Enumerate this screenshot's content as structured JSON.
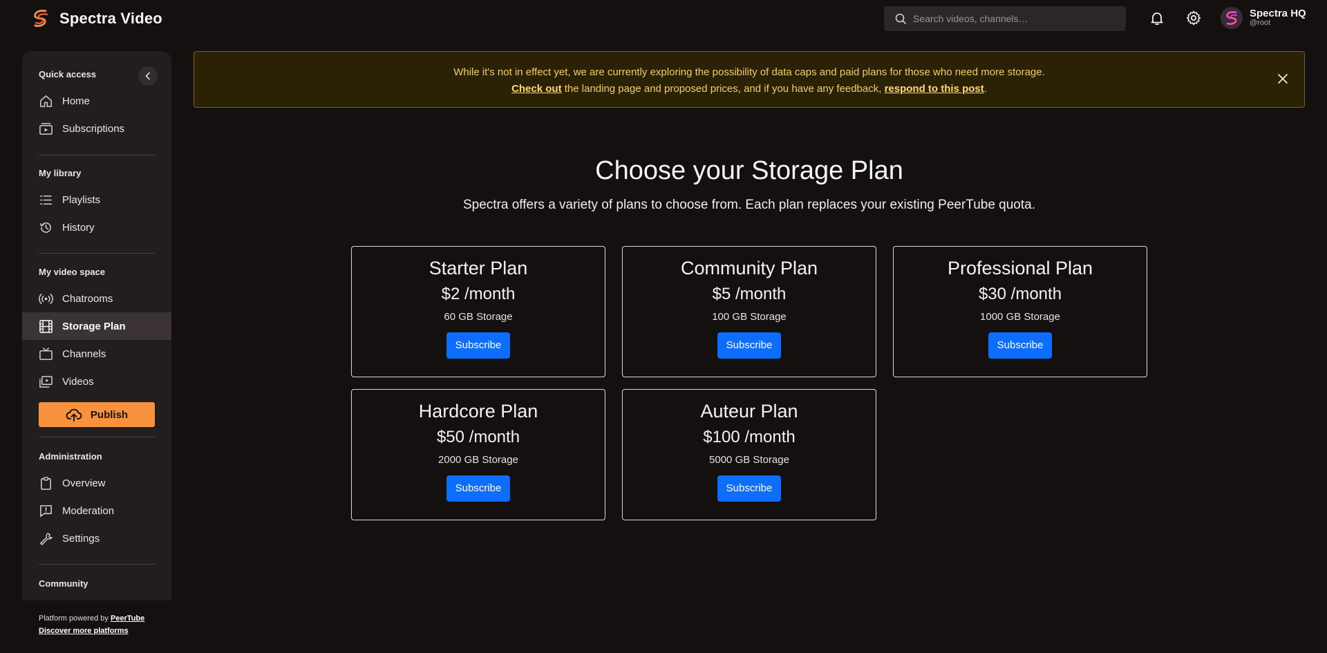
{
  "header": {
    "brand": "Spectra Video",
    "search_placeholder": "Search videos, channels…",
    "user_name": "Spectra HQ",
    "user_handle": "@root"
  },
  "sidebar": {
    "quick_access": "Quick access",
    "quick_items": [
      {
        "label": "Home",
        "icon": "home-icon"
      },
      {
        "label": "Subscriptions",
        "icon": "subscriptions-icon"
      }
    ],
    "my_library": "My library",
    "library_items": [
      {
        "label": "Playlists",
        "icon": "playlist-icon"
      },
      {
        "label": "History",
        "icon": "history-icon"
      }
    ],
    "my_video_space": "My video space",
    "space_items": [
      {
        "label": "Chatrooms",
        "icon": "broadcast-icon"
      },
      {
        "label": "Storage Plan",
        "icon": "film-icon",
        "active": true
      },
      {
        "label": "Channels",
        "icon": "tv-icon"
      },
      {
        "label": "Videos",
        "icon": "video-icon"
      }
    ],
    "publish_label": "Publish",
    "administration": "Administration",
    "admin_items": [
      {
        "label": "Overview",
        "icon": "clipboard-icon"
      },
      {
        "label": "Moderation",
        "icon": "flag-message-icon"
      },
      {
        "label": "Settings",
        "icon": "wrench-icon"
      }
    ],
    "community": "Community",
    "footer_powered": "Platform powered by ",
    "footer_peertube": "PeerTube",
    "footer_discover": "Discover more platforms"
  },
  "banner": {
    "line1": "While it's not in effect yet, we are currently exploring the possibility of data caps and paid plans for those who need more storage.",
    "link1": "Check out",
    "middle": " the landing page and proposed prices, and if you have any feedback, ",
    "link2": "respond to this post",
    "end": "."
  },
  "main": {
    "title": "Choose your Storage Plan",
    "subtitle": "Spectra offers a variety of plans to choose from. Each plan replaces your existing PeerTube quota.",
    "subscribe_label": "Subscribe",
    "plans": [
      {
        "name": "Starter Plan",
        "price": "$2 /month",
        "storage": "60 GB Storage"
      },
      {
        "name": "Community Plan",
        "price": "$5 /month",
        "storage": "100 GB Storage"
      },
      {
        "name": "Professional Plan",
        "price": "$30 /month",
        "storage": "1000 GB Storage"
      },
      {
        "name": "Hardcore Plan",
        "price": "$50 /month",
        "storage": "2000 GB Storage"
      },
      {
        "name": "Auteur Plan",
        "price": "$100 /month",
        "storage": "5000 GB Storage"
      }
    ]
  },
  "colors": {
    "accent_orange": "#f9923f",
    "subscribe_blue": "#0d6efd",
    "banner_text": "#f2cd66"
  }
}
